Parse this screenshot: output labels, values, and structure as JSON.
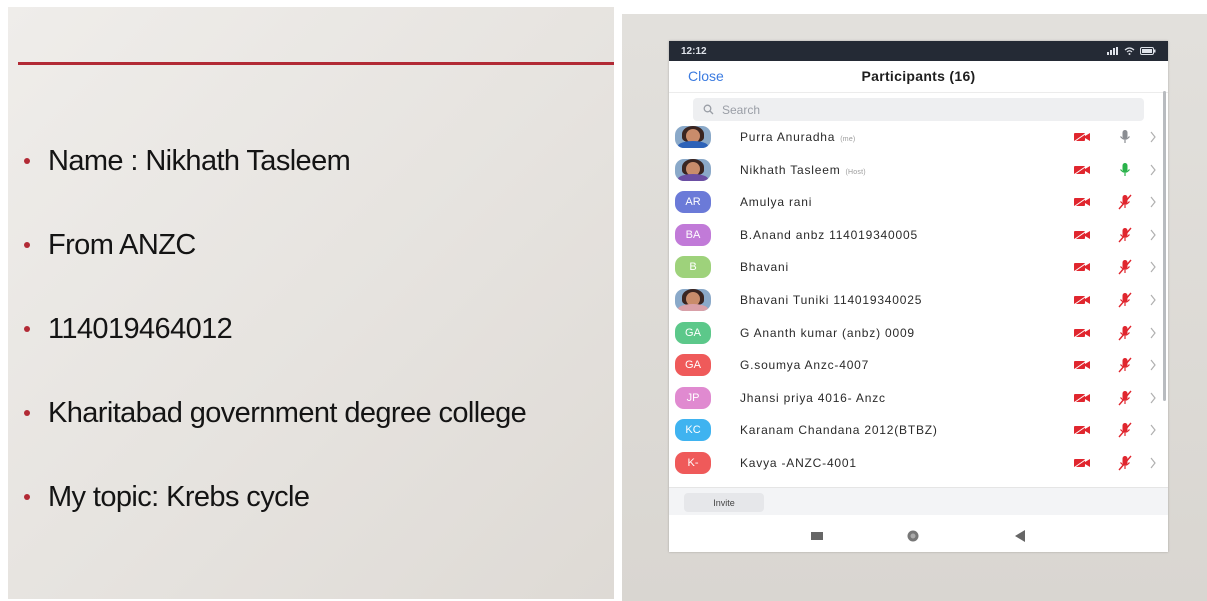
{
  "slide": {
    "bullets": [
      "Name : Nikhath Tasleem",
      "From ANZC",
      "114019464012",
      "Kharitabad government degree college",
      "My topic: Krebs cycle"
    ],
    "accent_color": "#b22a35"
  },
  "phone": {
    "status_time": "12:12",
    "close_label": "Close",
    "title": "Participants (16)",
    "search_placeholder": "Search",
    "invite_label": "Invite",
    "participants": [
      {
        "avatar_type": "photo",
        "initials": "",
        "color": "#2d62b8",
        "name": "Purra Anuradha",
        "role": "(me)",
        "video": "red",
        "mic": "gray"
      },
      {
        "avatar_type": "photo",
        "initials": "",
        "color": "#6b4ea3",
        "name": "Nikhath Tasleem",
        "role": "(Host)",
        "video": "red",
        "mic": "green"
      },
      {
        "avatar_type": "initials",
        "initials": "AR",
        "color": "#6b7ad8",
        "name": "Amulya rani",
        "role": "",
        "video": "red",
        "mic": "muted"
      },
      {
        "avatar_type": "initials",
        "initials": "BA",
        "color": "#c17ad8",
        "name": "B.Anand anbz 114019340005",
        "role": "",
        "video": "red",
        "mic": "muted"
      },
      {
        "avatar_type": "initials",
        "initials": "B",
        "color": "#9ed27b",
        "name": "Bhavani",
        "role": "",
        "video": "red",
        "mic": "muted"
      },
      {
        "avatar_type": "photo",
        "initials": "",
        "color": "#d9a0a8",
        "name": "Bhavani Tuniki 114019340025",
        "role": "",
        "video": "red",
        "mic": "muted"
      },
      {
        "avatar_type": "initials",
        "initials": "GA",
        "color": "#5cc88a",
        "name": "G Ananth kumar (anbz) 0009",
        "role": "",
        "video": "red",
        "mic": "muted"
      },
      {
        "avatar_type": "initials",
        "initials": "GA",
        "color": "#ef5a5a",
        "name": "G.soumya Anzc-4007",
        "role": "",
        "video": "red",
        "mic": "muted"
      },
      {
        "avatar_type": "initials",
        "initials": "JP",
        "color": "#e08ad0",
        "name": "Jhansi priya 4016- Anzc",
        "role": "",
        "video": "red",
        "mic": "muted"
      },
      {
        "avatar_type": "initials",
        "initials": "KC",
        "color": "#3fb3f0",
        "name": "Karanam Chandana 2012(BTBZ)",
        "role": "",
        "video": "red",
        "mic": "muted"
      },
      {
        "avatar_type": "initials",
        "initials": "K-",
        "color": "#ef5a5a",
        "name": "Kavya -ANZC-4001",
        "role": "",
        "video": "red",
        "mic": "muted"
      }
    ],
    "icons": {
      "video_off": "video-off-icon",
      "mic_muted": "mic-muted-icon",
      "mic_on": "mic-icon",
      "chevron": "chevron-right-icon"
    }
  }
}
